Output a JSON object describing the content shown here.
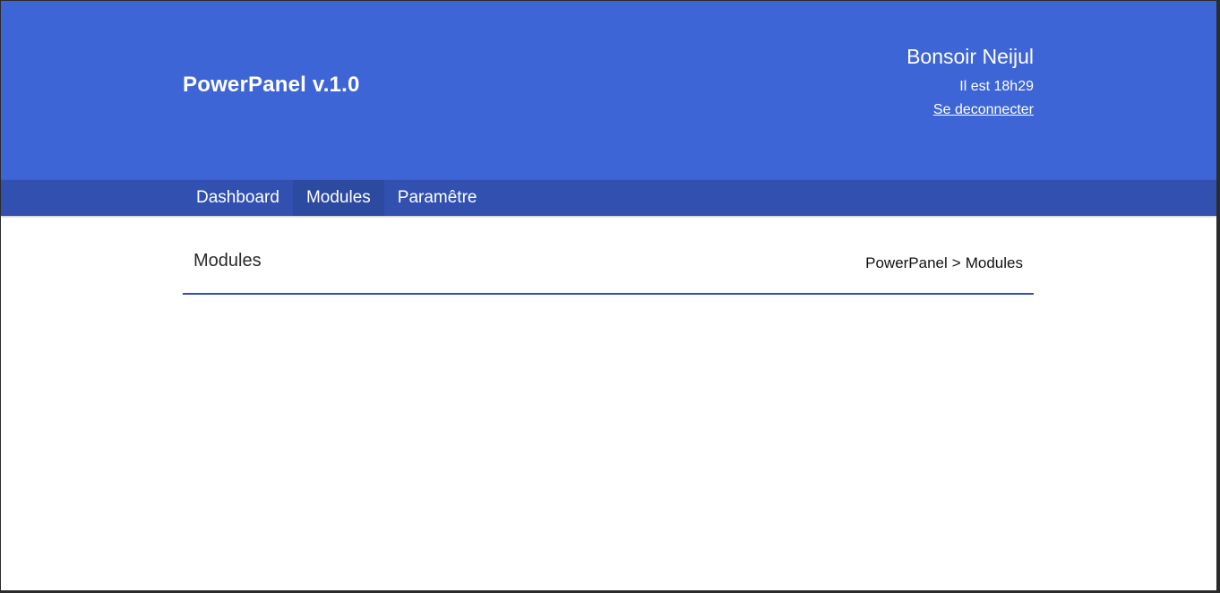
{
  "app": {
    "title": "PowerPanel v.1.0"
  },
  "user": {
    "greeting": "Bonsoir Neijul",
    "time_text": "Il est 18h29",
    "logout_label": "Se deconnecter"
  },
  "nav": {
    "items": [
      {
        "label": "Dashboard"
      },
      {
        "label": "Modules"
      },
      {
        "label": "Paramêtre"
      }
    ],
    "active": "Modules"
  },
  "page": {
    "title": "Modules",
    "breadcrumb": {
      "root": "PowerPanel",
      "separator": ">",
      "current": "Modules"
    }
  },
  "colors": {
    "header_bg": "#3e65d6",
    "nav_bg": "#3150b0",
    "nav_active_bg": "#2c4a9f",
    "divider": "#3150b0"
  }
}
